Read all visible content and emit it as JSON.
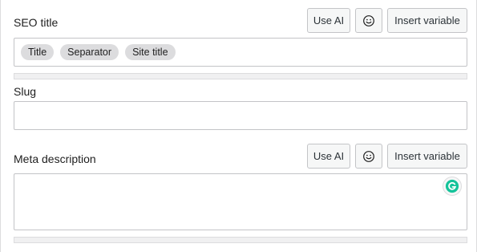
{
  "seo_title": {
    "label": "SEO title",
    "use_ai_label": "Use AI",
    "insert_variable_label": "Insert variable",
    "tokens": [
      "Title",
      "Separator",
      "Site title"
    ]
  },
  "slug": {
    "label": "Slug",
    "value": ""
  },
  "meta_description": {
    "label": "Meta description",
    "use_ai_label": "Use AI",
    "insert_variable_label": "Insert variable",
    "value": ""
  },
  "icons": {
    "emoji": "smiley-face-icon",
    "grammarly": "grammarly-icon"
  },
  "colors": {
    "pill_bg": "#dcdcde",
    "border": "#c3c4c7",
    "grammarly_green": "#15c39a"
  }
}
